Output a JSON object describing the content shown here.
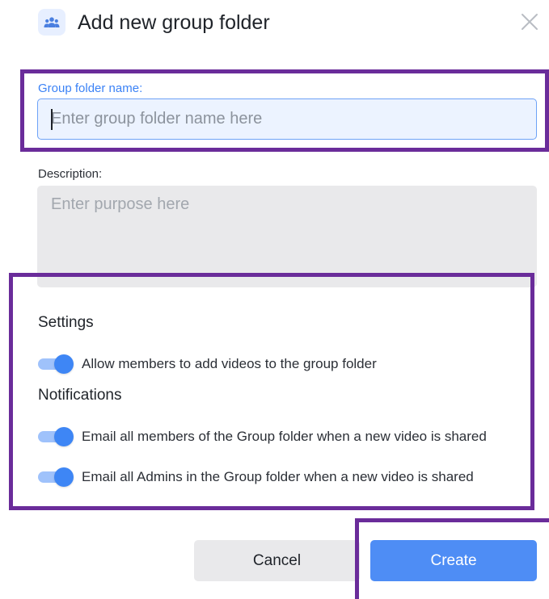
{
  "dialog": {
    "title": "Add new group folder",
    "header_icon": "group-icon",
    "close_icon": "close-icon"
  },
  "form": {
    "name_label": "Group folder name:",
    "name_placeholder": "Enter group folder name here",
    "name_value": "",
    "description_label": "Description:",
    "description_placeholder": "Enter purpose here",
    "description_value": ""
  },
  "settings": {
    "heading": "Settings",
    "items": [
      {
        "label": "Allow members to add videos to the group folder",
        "enabled": true
      }
    ]
  },
  "notifications": {
    "heading": "Notifications",
    "items": [
      {
        "label": "Email all members of the Group folder when a new video is shared",
        "enabled": true
      },
      {
        "label": "Email all Admins in the Group folder when a new video is shared",
        "enabled": true
      }
    ]
  },
  "actions": {
    "cancel_label": "Cancel",
    "create_label": "Create"
  },
  "colors": {
    "accent": "#3e86f5",
    "primary_button": "#4e8df5",
    "secondary_button": "#e9e9eb",
    "highlight_box": "#6a2c9a"
  }
}
